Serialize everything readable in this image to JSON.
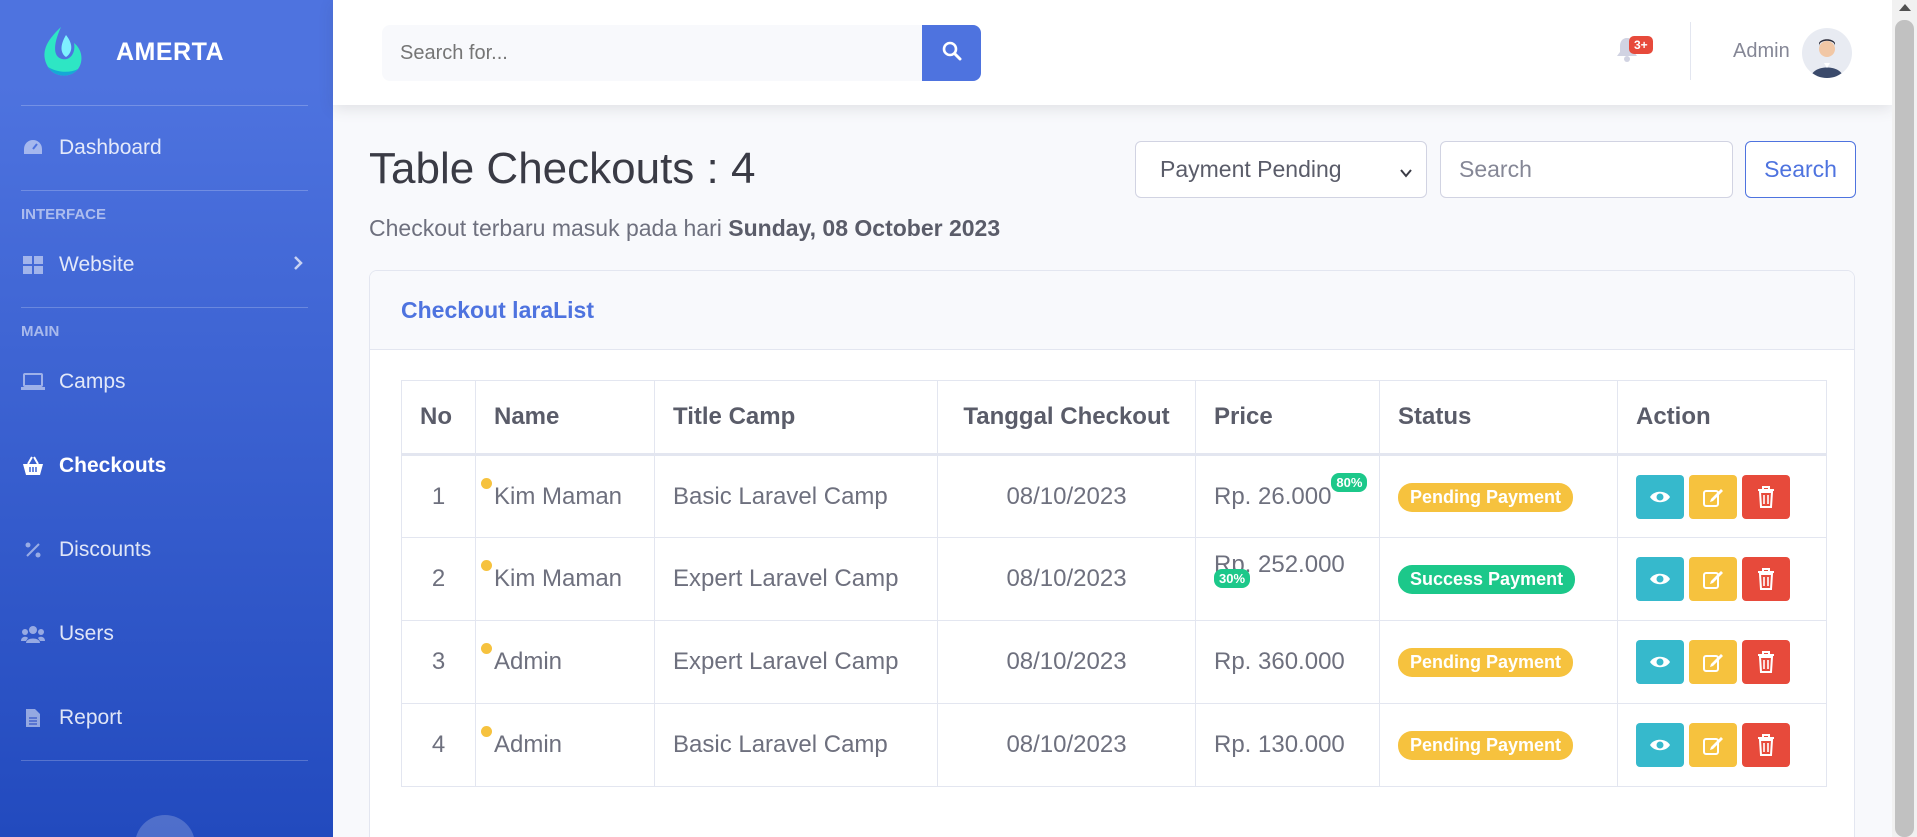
{
  "brand": {
    "name": "AMERTA"
  },
  "sidebar": {
    "dashboard": "Dashboard",
    "heading_interface": "INTERFACE",
    "website": "Website",
    "heading_main": "MAIN",
    "camps": "Camps",
    "checkouts": "Checkouts",
    "discounts": "Discounts",
    "users": "Users",
    "report": "Report"
  },
  "topbar": {
    "search_placeholder": "Search for...",
    "notification_count": "3+",
    "user_name": "Admin"
  },
  "page": {
    "title": "Table Checkouts : 4",
    "subtitle_prefix": "Checkout terbaru masuk pada hari ",
    "subtitle_date": "Sunday, 08 October 2023",
    "filter_selected": "Payment Pending",
    "search_placeholder": "Search",
    "search_button": "Search"
  },
  "card": {
    "title": "Checkout laraList",
    "columns": [
      "No",
      "Name",
      "Title Camp",
      "Tanggal Checkout",
      "Price",
      "Status",
      "Action"
    ],
    "rows": [
      {
        "no": "1",
        "name": "Kim Maman",
        "camp": "Basic Laravel Camp",
        "date": "08/10/2023",
        "price": "Rp. 26.000",
        "discount": "80%",
        "status": "Pending Payment"
      },
      {
        "no": "2",
        "name": "Kim Maman",
        "camp": "Expert Laravel Camp",
        "date": "08/10/2023",
        "price": "Rp. 252.000",
        "discount": "30%",
        "status": "Success Payment"
      },
      {
        "no": "3",
        "name": "Admin",
        "camp": "Expert Laravel Camp",
        "date": "08/10/2023",
        "price": "Rp. 360.000",
        "discount": "",
        "status": "Pending Payment"
      },
      {
        "no": "4",
        "name": "Admin",
        "camp": "Basic Laravel Camp",
        "date": "08/10/2023",
        "price": "Rp. 130.000",
        "discount": "",
        "status": "Pending Payment"
      }
    ]
  },
  "colors": {
    "primary": "#4e73df",
    "pending": "#f6c23e",
    "success": "#1cc88a",
    "info": "#36b9cc",
    "danger": "#e74a3b"
  }
}
